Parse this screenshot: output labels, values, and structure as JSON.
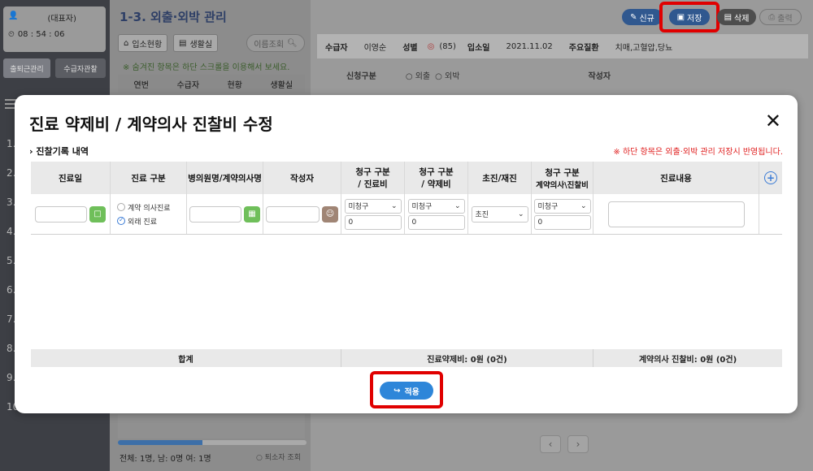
{
  "sidebar": {
    "user_name": "",
    "user_role": "(대표자)",
    "clock": "08 : 54 : 06",
    "btn_attendance": "출퇴근관리",
    "btn_observe": "수급자관찰",
    "numbers": [
      "1.",
      "2.",
      "3.",
      "4.",
      "5.",
      "6.",
      "7.",
      "8.",
      "9.",
      "10"
    ]
  },
  "middle": {
    "title": "1-3. 외출·외박 관리",
    "tab_admission": "입소현황",
    "tab_room": "생활실",
    "search_label": "이름조회",
    "hint": "※ 숨겨진 항목은 하단 스크롤을 이용해서 보세요.",
    "columns": [
      "연번",
      "수급자",
      "현황",
      "생활실"
    ],
    "footer": "전체: 1명, 남: 0명 여: 1명",
    "footer_right": "퇴소자 조회",
    "progress": 0.45
  },
  "main": {
    "btn_new": "신규",
    "btn_save": "저장",
    "btn_delete": "삭제",
    "btn_print": "출력",
    "info": {
      "recipient_label": "수급자",
      "recipient": "이영순",
      "gender_label": "성별",
      "age": "(85)",
      "admission_label": "입소일",
      "admission_date": "2021.11.02",
      "disease_label": "주요질환",
      "disease": "치매,고혈압,당뇨"
    },
    "apply_type_label": "신청구분",
    "opt_out": "외출",
    "opt_overnight": "외박",
    "writer_label": "작성자"
  },
  "modal": {
    "title": "진료 약제비 / 계약의사 진찰비 수정",
    "section": "진찰기록 내역",
    "notice": "※ 하단 항목은 외출·외박 관리 저장시 반영됩니다.",
    "headers": {
      "date": "진료일",
      "type": "진료 구분",
      "hospital": "병의원명/계약의사명",
      "writer": "작성자",
      "claim_fee_1": "청구 구분",
      "claim_fee_2": "/ 진료비",
      "claim_drug_1": "청구 구분",
      "claim_drug_2": "/ 약제비",
      "visit": "초진/재진",
      "claim_doctor_1": "청구 구분",
      "claim_doctor_2": "계약의사\\진찰비",
      "content": "진료내용"
    },
    "row": {
      "type_option_1": "계약 의사진료",
      "type_option_2": "외래 진료",
      "claim_fee_select": "미청구",
      "claim_fee_value": "0",
      "claim_drug_select": "미청구",
      "claim_drug_value": "0",
      "visit_select": "초진",
      "claim_doctor_select": "미청구",
      "claim_doctor_value": "0"
    },
    "summary": {
      "total": "합계",
      "drug_total": "진료약제비: 0원 (0건)",
      "doctor_total": "계약의사 진찰비: 0원 (0건)"
    },
    "apply_label": "적용"
  }
}
